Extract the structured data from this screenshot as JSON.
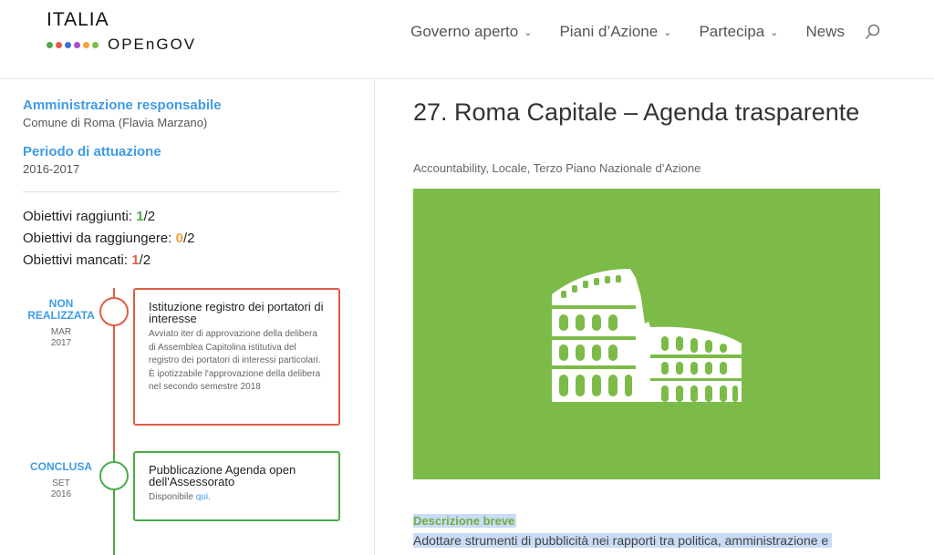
{
  "logo": {
    "top": "ITALIA",
    "bottom": "OPEnGOV",
    "dot_colors": [
      "#4caa48",
      "#e05d44",
      "#3f6fd8",
      "#a64fc8",
      "#f2a33a",
      "#7cbb47"
    ]
  },
  "nav": {
    "items": [
      {
        "label": "Governo aperto",
        "has_dropdown": true
      },
      {
        "label": "Piani d’Azione",
        "has_dropdown": true
      },
      {
        "label": "Partecipa",
        "has_dropdown": true
      },
      {
        "label": "News",
        "has_dropdown": false
      }
    ],
    "search_icon": "search-icon"
  },
  "sidebar": {
    "admin_label": "Amministrazione responsabile",
    "admin_value": "Comune di Roma (Flavia Marzano)",
    "period_label": "Periodo di attuazione",
    "period_value": "2016-2017",
    "stats": [
      {
        "label": "Obiettivi raggiunti:",
        "count": "1",
        "total": "/2",
        "color": "#4caa48"
      },
      {
        "label": "Obiettivi da raggiungere:",
        "count": "0",
        "total": "/2",
        "color": "#f2a33a"
      },
      {
        "label": "Obiettivi mancati:",
        "count": "1",
        "total": "/2",
        "color": "#e05d44"
      }
    ],
    "timeline": [
      {
        "status_line1": "NON",
        "status_line2": "REALIZZATA",
        "month": "MAR",
        "year": "2017",
        "color": "#e05d44",
        "title": "Istituzione registro dei portatori di interesse",
        "body": "Avviato iter di approvazione della delibera di Assemblea Capitolina istitutiva del registro dei portatori di interessi particolari. È ipotizzabile l'approvazione della delibera nel secondo semestre 2018"
      },
      {
        "status_line1": "CONCLUSA",
        "status_line2": "",
        "month": "SET",
        "year": "2016",
        "color": "#4caa48",
        "title": "Pubblicazione Agenda open dell'Assessorato",
        "body_prefix": "Disponibile ",
        "body_link": "qui",
        "body_suffix": "."
      }
    ]
  },
  "main": {
    "title": "27. Roma Capitale – Agenda trasparente",
    "tags": "Accountability, Locale, Terzo Piano Nazionale d’Azione",
    "hero_color": "#7cbb47",
    "hero_icon": "colosseum-icon",
    "desc_label": "Descrizione breve",
    "desc_text": "Adottare strumenti di pubblicità nei rapporti tra politica, amministrazione e"
  }
}
